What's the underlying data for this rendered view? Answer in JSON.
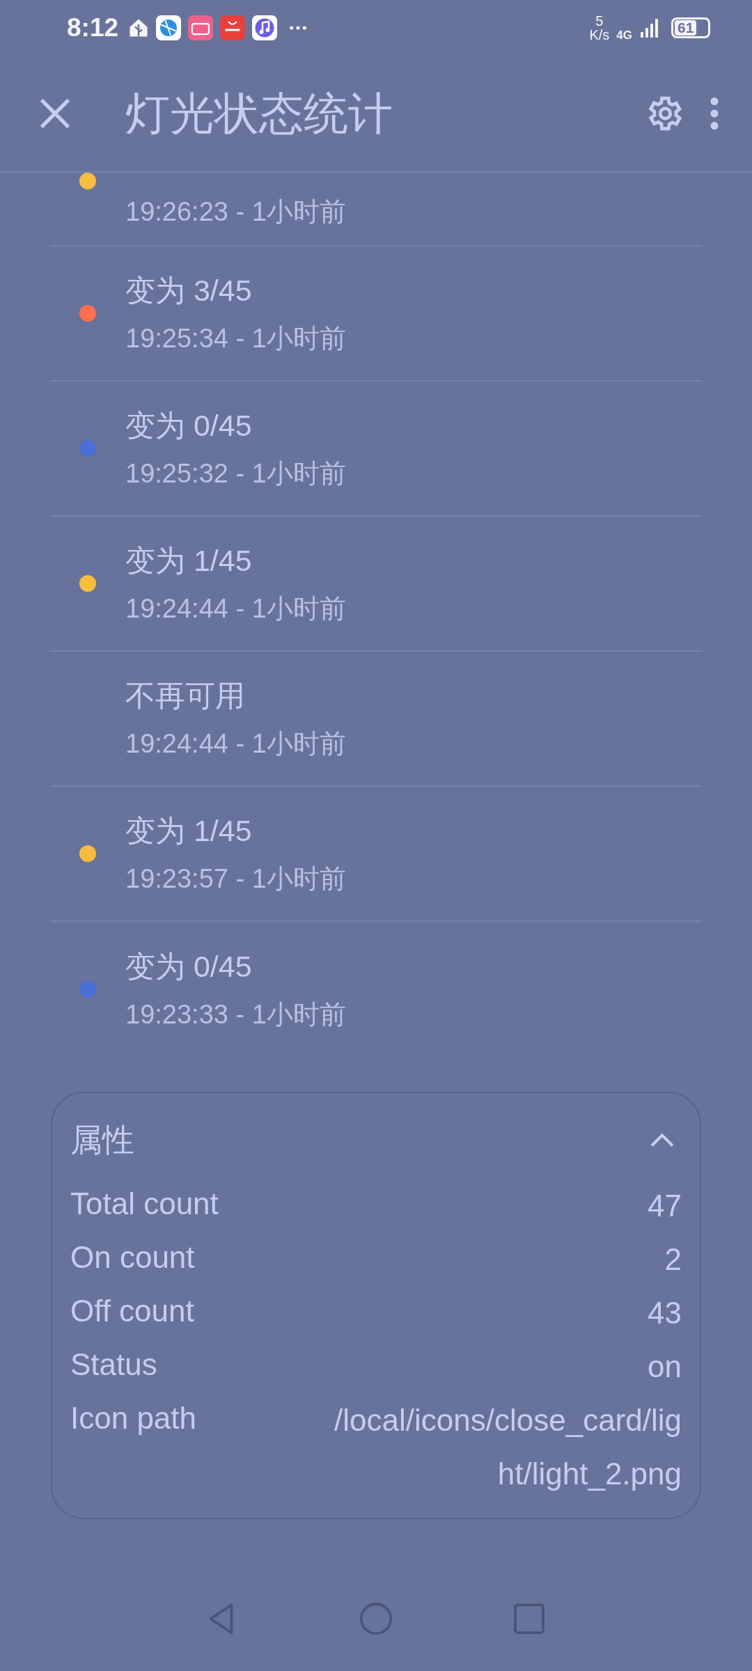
{
  "status_bar": {
    "time": "8:12",
    "net_speed_value": "5",
    "net_speed_unit": "K/s",
    "network": "4G",
    "battery": "61"
  },
  "app_bar": {
    "title": "灯光状态统计"
  },
  "history": [
    {
      "time": "19:26:23 - 1小时前",
      "color": "#f6be3f"
    },
    {
      "title": "变为 3/45",
      "time": "19:25:34 - 1小时前",
      "color": "#ff6e50"
    },
    {
      "title": "变为 0/45",
      "time": "19:25:32 - 1小时前",
      "color": "#4a6fd6"
    },
    {
      "title": "变为 1/45",
      "time": "19:24:44 - 1小时前",
      "color": "#f6be3f"
    },
    {
      "title": "不再可用",
      "time": "19:24:44 - 1小时前"
    },
    {
      "title": "变为 1/45",
      "time": "19:23:57 - 1小时前",
      "color": "#f6be3f"
    },
    {
      "title": "变为 0/45",
      "time": "19:23:33 - 1小时前",
      "color": "#4a6fd6"
    }
  ],
  "attributes": {
    "title": "属性",
    "expanded": true,
    "rows": [
      {
        "name": "Total count",
        "value": "47"
      },
      {
        "name": "On count",
        "value": "2"
      },
      {
        "name": "Off count",
        "value": "43"
      },
      {
        "name": "Status",
        "value": "on"
      },
      {
        "name": "Icon path",
        "value": "/local/icons/close_card/light/light_2.png"
      }
    ]
  }
}
